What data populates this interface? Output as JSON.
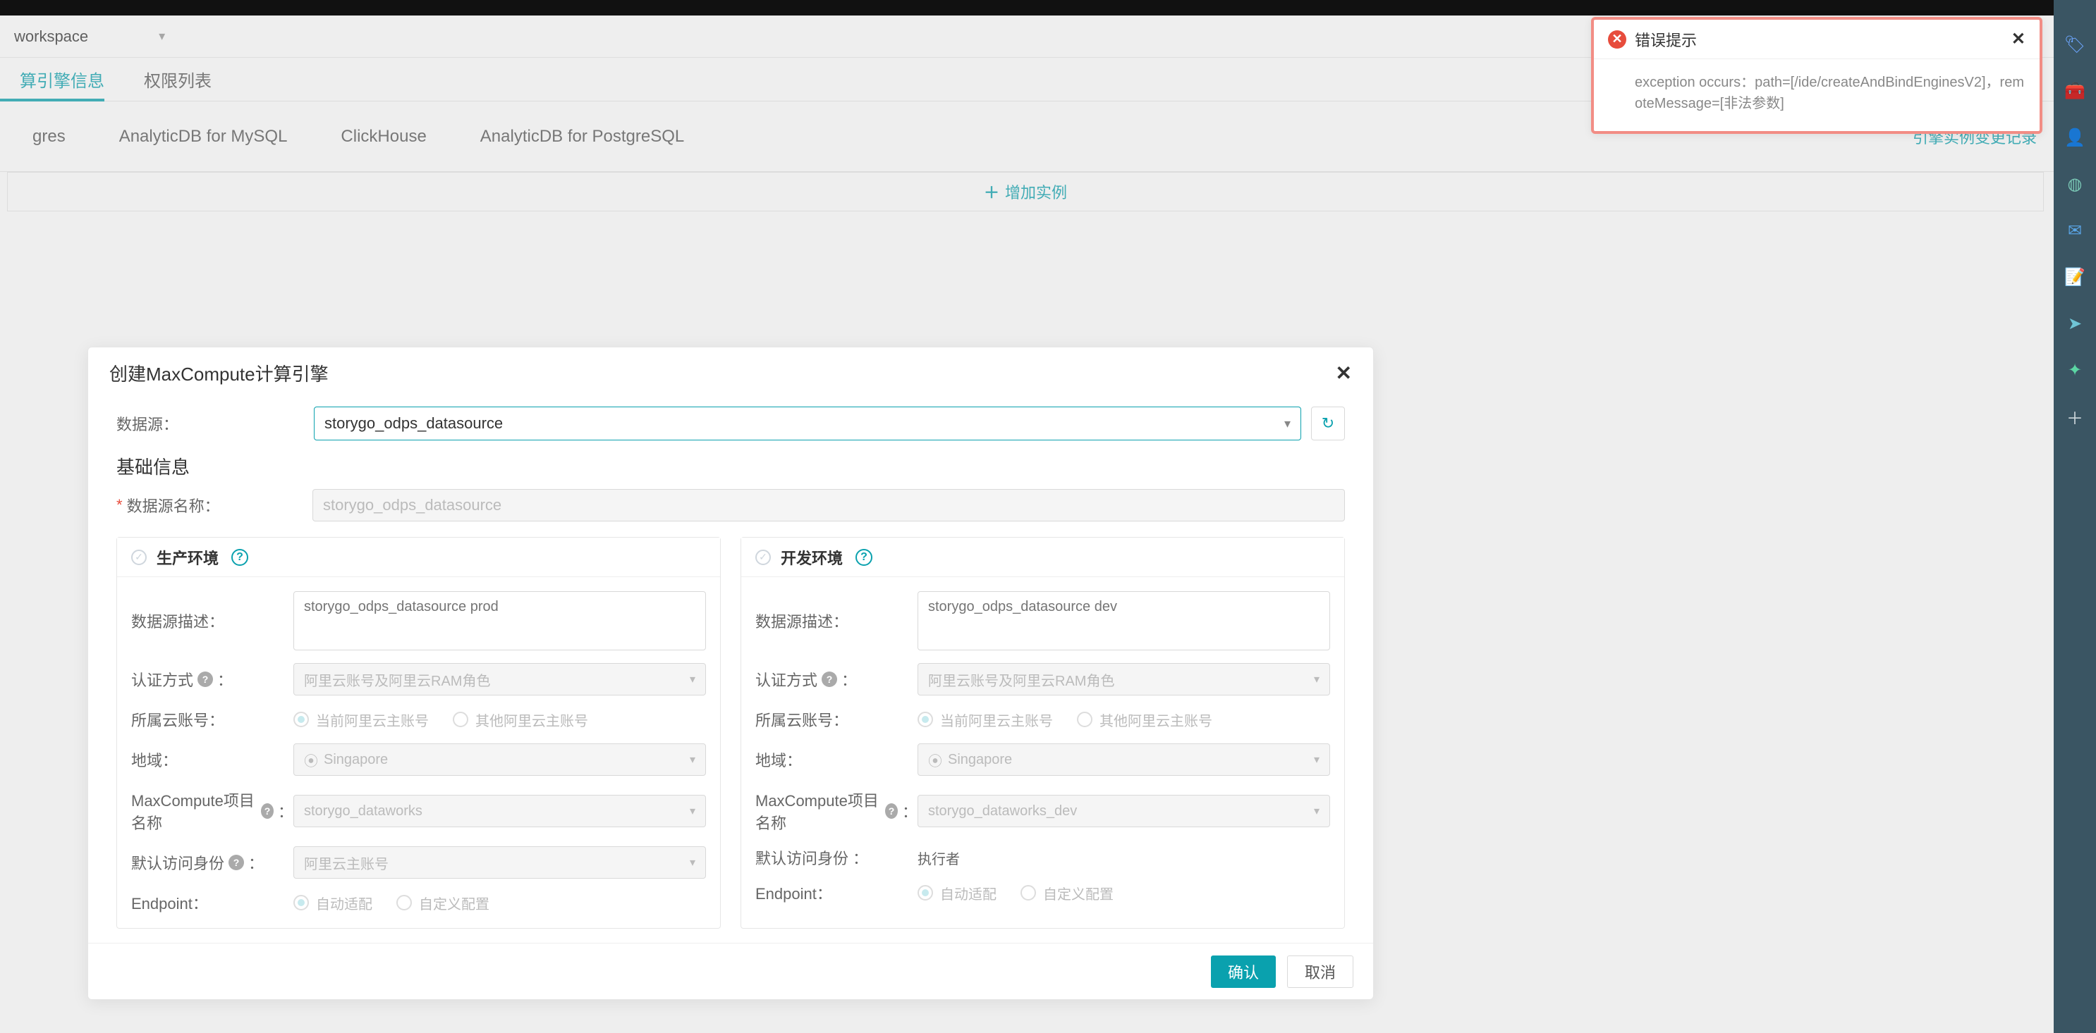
{
  "workspace": {
    "selected": "workspace"
  },
  "subTabs": {
    "engineInfo": "算引擎信息",
    "permissionList": "权限列表"
  },
  "engineTabs": {
    "gres": "gres",
    "adbMysql": "AnalyticDB for MySQL",
    "clickhouse": "ClickHouse",
    "adbPg": "AnalyticDB for PostgreSQL"
  },
  "engineChangeLog": "引擎实例变更记录",
  "addInstance": "增加实例",
  "modal": {
    "title": "创建MaxCompute计算引擎",
    "dsLabel": "数据源：",
    "dsValue": "storygo_odps_datasource",
    "basicInfo": "基础信息",
    "nameLabel": "数据源名称：",
    "nameValue": "storygo_odps_datasource",
    "prodTitle": "生产环境",
    "devTitle": "开发环境",
    "descLabel": "数据源描述：",
    "authLabel": "认证方式",
    "accountLabel": "所属云账号：",
    "regionLabel": "地域：",
    "projectLabel": "MaxCompute项目名称",
    "defaultIdentityLabel": "默认访问身份",
    "endpointLabel": "Endpoint：",
    "auto": "自动适配",
    "custom": "自定义配置",
    "curAccount": "当前阿里云主账号",
    "otherAccount": "其他阿里云主账号",
    "prod": {
      "desc": "storygo_odps_datasource prod",
      "auth": "阿里云账号及阿里云RAM角色",
      "region": "Singapore",
      "project": "storygo_dataworks",
      "identity": "阿里云主账号"
    },
    "dev": {
      "desc": "storygo_odps_datasource dev",
      "auth": "阿里云账号及阿里云RAM角色",
      "region": "Singapore",
      "project": "storygo_dataworks_dev",
      "identityStatic": "执行者"
    },
    "ok": "确认",
    "cancel": "取消"
  },
  "toast": {
    "title": "错误提示",
    "body": "exception occurs：path=[/ide/createAndBindEnginesV2]，remoteMessage=[非法参数]"
  },
  "glyph": {
    "plus": "＋",
    "x": "✕",
    "caret": "▾",
    "check": "✓",
    "refresh": "↻",
    "q": "?",
    "pin": "⦿"
  }
}
